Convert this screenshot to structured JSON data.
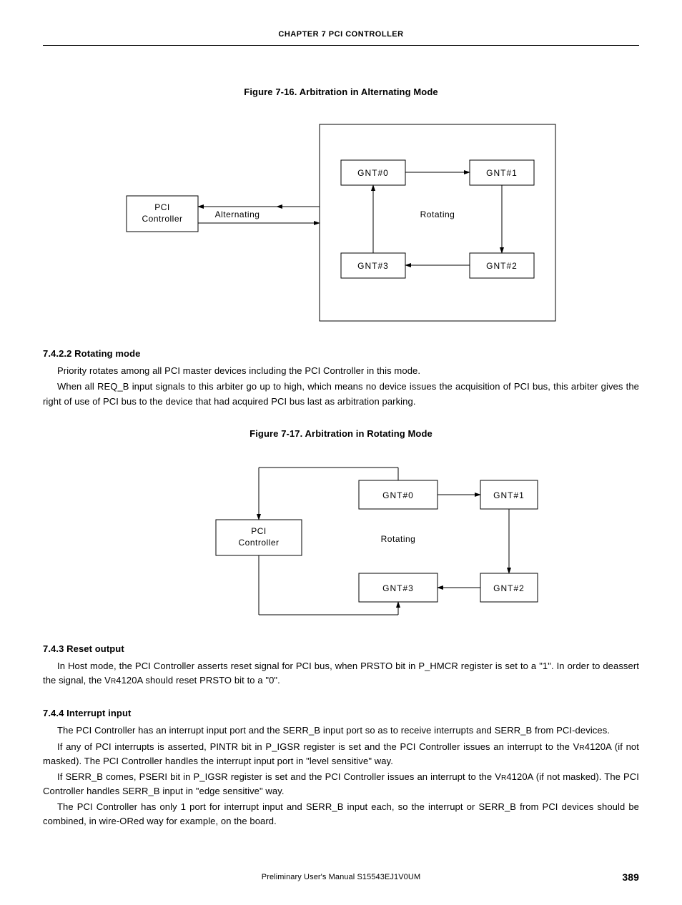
{
  "header": "CHAPTER  7   PCI CONTROLLER",
  "fig16_caption": "Figure 7-16.  Arbitration in Alternating Mode",
  "fig17_caption": "Figure 7-17.  Arbitration in Rotating Mode",
  "diagram": {
    "pci_controller_l1": "PCI",
    "pci_controller_l2": "Controller",
    "alternating": "Alternating",
    "rotating": "Rotating",
    "gnt0": "GNT#0",
    "gnt1": "GNT#1",
    "gnt2": "GNT#2",
    "gnt3": "GNT#3"
  },
  "s7422_head": "7.4.2.2  Rotating mode",
  "s7422_p1": "Priority rotates among all PCI master devices including the PCI Controller in this mode.",
  "s7422_p2": "When all REQ_B input signals to this arbiter go up to high, which means no device issues the acquisition of PCI bus, this arbiter gives the right of use of PCI bus to the device that had acquired PCI bus last as arbitration parking.",
  "s743_head": "7.4.3  Reset output",
  "s743_p1a": "In Host mode, the PCI Controller asserts reset signal for PCI bus, when PRSTO bit in P_HMCR register is set to a \"1\". In order to deassert the signal, the V",
  "s743_p1b": "4120A should reset PRSTO bit to a \"0\".",
  "vr_sub": "R",
  "s744_head": "7.4.4  Interrupt input",
  "s744_p1": "The PCI Controller has an interrupt input port and the SERR_B input port so as to receive interrupts and SERR_B from PCI-devices.",
  "s744_p2a": "If any of PCI interrupts is asserted, PINTR bit in P_IGSR register is set and the PCI Controller issues an interrupt to the V",
  "s744_p2b": "4120A (if not masked). The PCI Controller handles the interrupt input port in \"level sensitive\" way.",
  "s744_p3a": "If SERR_B comes, PSERI bit in P_IGSR register is set and the PCI Controller issues an interrupt to the V",
  "s744_p3b": "4120A (if not masked). The PCI Controller handles SERR_B input in \"edge sensitive\" way.",
  "s744_p4": "The PCI Controller has only 1 port for interrupt input and SERR_B input each, so the interrupt or SERR_B from PCI devices should be combined, in wire-ORed way for example, on the board.",
  "footer_center": "Preliminary User's Manual  S15543EJ1V0UM",
  "footer_right": "389"
}
